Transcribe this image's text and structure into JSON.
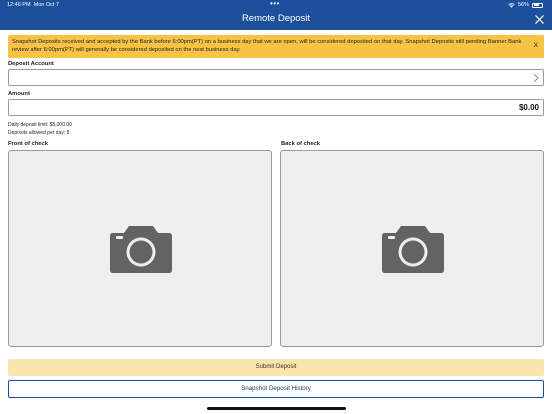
{
  "status_bar": {
    "time": "12:46 PM",
    "date": "Mon Oct 7",
    "multitask_dots": "•••",
    "battery_percent": "56%",
    "battery_level": 0.56
  },
  "nav": {
    "title": "Remote Deposit",
    "close_icon": "close-icon"
  },
  "banner": {
    "message": "Snapshot Deposits received and accepted by the Bank before 6:00pm(PT) on a business day that we are open, will be considered deposited on that day. Snapshot Deposits still pending Banner Bank review after 6:00pm(PT) will generally be considered deposited on the next business day.",
    "dismiss": "X",
    "color": "#f6c345"
  },
  "deposit_account": {
    "label": "Deposit Account",
    "value": ""
  },
  "amount": {
    "label": "Amount",
    "value": "$0.00"
  },
  "limits": {
    "daily": "Daily deposit limit: $5,000.00",
    "per_day": "Deposits allowed per day: 5"
  },
  "front": {
    "label": "Front of check",
    "icon": "camera-icon"
  },
  "back": {
    "label": "Back of check",
    "icon": "camera-icon"
  },
  "actions": {
    "submit": "Submit Deposit",
    "history": "Snapshot Deposit History"
  },
  "colors": {
    "brand": "#1c4f9c",
    "submit_bg": "#f9e6ac"
  }
}
